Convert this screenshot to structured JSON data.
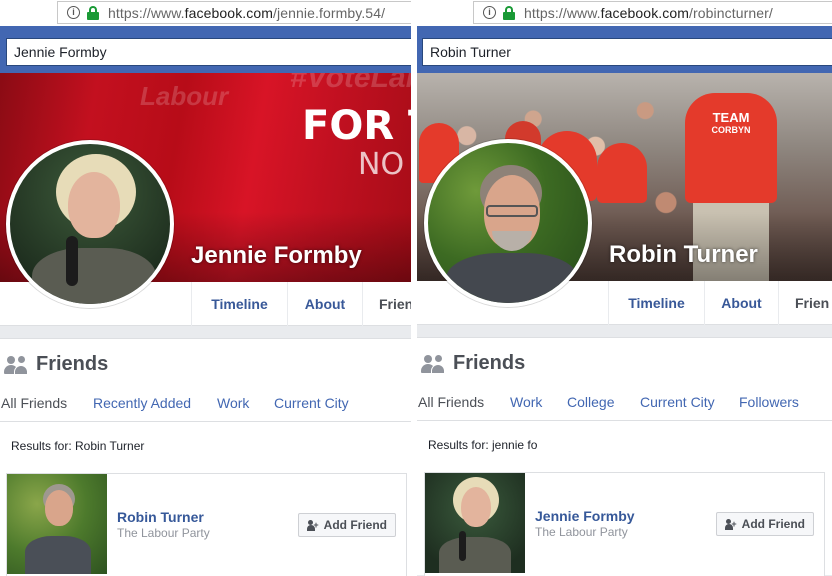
{
  "left": {
    "url": {
      "prefix": "https://www.",
      "domain": "facebook.com",
      "path": "/jennie.formby.54/"
    },
    "search_value": "Jennie Formby",
    "profile_name": "Jennie Formby",
    "cover_text": {
      "line1": "FOR T",
      "line2": "NO",
      "faded": "#VoteLab",
      "faded2": "Labour"
    },
    "tabs": [
      "Timeline",
      "About",
      "Frien"
    ],
    "friends_title": "Friends",
    "subtabs": [
      "All Friends",
      "Recently Added",
      "Work",
      "Current City"
    ],
    "results_for": "Results for: Robin Turner",
    "friend": {
      "name": "Robin Turner",
      "subtitle": "The Labour Party",
      "button": "Add Friend"
    }
  },
  "right": {
    "url": {
      "prefix": "https://www.",
      "domain": "facebook.com",
      "path": "/robincturner/"
    },
    "search_value": "Robin Turner",
    "profile_name": "Robin Turner",
    "shirt_text": {
      "line1": "TEAM",
      "line2": "CORBYN"
    },
    "tabs": [
      "Timeline",
      "About",
      "Frien"
    ],
    "friends_title": "Friends",
    "subtabs": [
      "All Friends",
      "Work",
      "College",
      "Current City",
      "Followers"
    ],
    "results_for": "Results for: jennie fo",
    "friend": {
      "name": "Jennie Formby",
      "subtitle": "The Labour Party",
      "button": "Add Friend"
    }
  },
  "colors": {
    "facebook_blue": "#4267b2",
    "link_blue": "#385898",
    "labour_red": "#c3101f",
    "secure_green": "#1a9a36"
  }
}
